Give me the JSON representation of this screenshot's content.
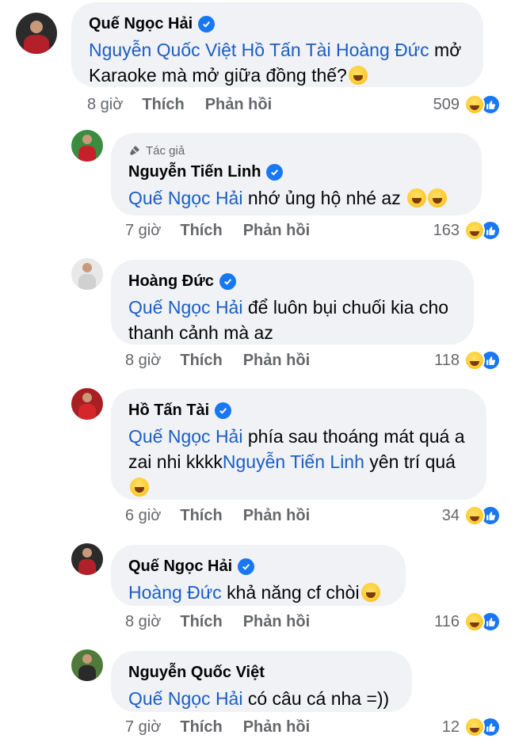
{
  "comments": [
    {
      "name": "Quế Ngọc Hải",
      "verified": true,
      "author_tag": "",
      "lines": [
        {
          "parts": [
            {
              "t": "Nguyễn Quốc Việt Hồ Tấn Tài Hoàng Đức",
              "m": true
            },
            {
              "t": " mở",
              "m": false
            }
          ]
        },
        {
          "parts": [
            {
              "t": "Karaoke mà mở giữa đồng thế?",
              "m": false
            }
          ],
          "emoji": "rofl"
        }
      ],
      "time": "8 giờ",
      "like": "Thích",
      "reply": "Phản hồi",
      "reaction_count": "509",
      "reactions": [
        "haha",
        "like"
      ]
    },
    {
      "name": "Nguyễn Tiến Linh",
      "verified": true,
      "author_tag": "Tác giả",
      "lines": [
        {
          "parts": [
            {
              "t": "Quế Ngọc Hải",
              "m": true
            },
            {
              "t": "  nhớ ủng hộ nhé az ",
              "m": false
            }
          ],
          "emoji": "rofl rofl"
        }
      ],
      "time": "7 giờ",
      "like": "Thích",
      "reply": "Phản hồi",
      "reaction_count": "163",
      "reactions": [
        "haha",
        "like"
      ]
    },
    {
      "name": "Hoàng Đức",
      "verified": true,
      "author_tag": "",
      "lines": [
        {
          "parts": [
            {
              "t": "Quế Ngọc Hải",
              "m": true
            },
            {
              "t": " để luôn bụi chuối kia cho",
              "m": false
            }
          ]
        },
        {
          "parts": [
            {
              "t": "thanh cảnh mà az",
              "m": false
            }
          ]
        }
      ],
      "time": "8 giờ",
      "like": "Thích",
      "reply": "Phản hồi",
      "reaction_count": "118",
      "reactions": [
        "haha",
        "like"
      ]
    },
    {
      "name": "Hồ Tấn Tài",
      "verified": true,
      "author_tag": "",
      "lines": [
        {
          "parts": [
            {
              "t": "Quế Ngọc Hải",
              "m": true
            },
            {
              "t": " phía sau thoáng mát quá a",
              "m": false
            }
          ]
        },
        {
          "parts": [
            {
              "t": "zai nhi kkkk",
              "m": false
            },
            {
              "t": "Nguyễn Tiến Linh",
              "m": true
            },
            {
              "t": " yên trí quá",
              "m": false
            }
          ]
        },
        {
          "parts": [],
          "emoji": "joy"
        }
      ],
      "time": "6 giờ",
      "like": "Thích",
      "reply": "Phản hồi",
      "reaction_count": "34",
      "reactions": [
        "haha",
        "like"
      ]
    },
    {
      "name": "Quế Ngọc Hải",
      "verified": true,
      "author_tag": "",
      "lines": [
        {
          "parts": [
            {
              "t": "Hoàng Đức",
              "m": true
            },
            {
              "t": " khả năng cf chòi",
              "m": false
            }
          ],
          "emoji": "rofl"
        }
      ],
      "time": "8 giờ",
      "like": "Thích",
      "reply": "Phản hồi",
      "reaction_count": "116",
      "reactions": [
        "haha",
        "like"
      ]
    },
    {
      "name": "Nguyễn Quốc Việt",
      "verified": false,
      "author_tag": "",
      "lines": [
        {
          "parts": [
            {
              "t": "Quế Ngọc Hải",
              "m": true
            },
            {
              "t": " có câu cá nha =))",
              "m": false
            }
          ]
        }
      ],
      "time": "7 giờ",
      "like": "Thích",
      "reply": "Phản hồi",
      "reaction_count": "12",
      "reactions": [
        "haha",
        "like"
      ]
    }
  ],
  "colors": {
    "mention": "#1a5ec7",
    "bubble": "#f0f2f5",
    "meta": "#65676b",
    "verified": "#1877f2"
  }
}
